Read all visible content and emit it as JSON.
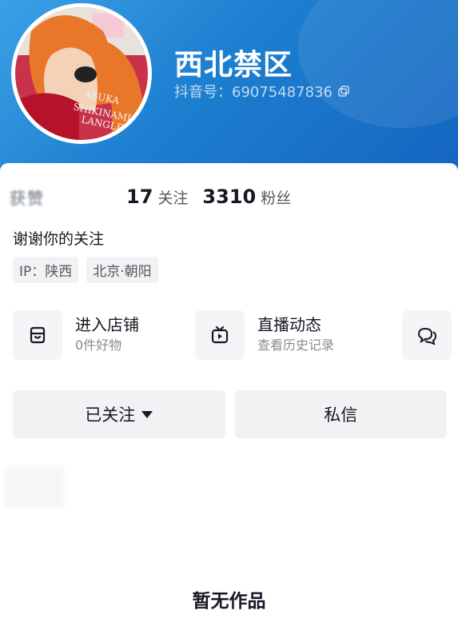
{
  "profile": {
    "nickname": "西北禁区",
    "id_label": "抖音号：69075487836",
    "avatar_lettering": [
      "ASUKA",
      "SHIKINAMI",
      "LANGLEY"
    ]
  },
  "stats": {
    "likes_blurred": "获赞",
    "following_count": "17",
    "following_label": "关注",
    "followers_count": "3310",
    "followers_label": "粉丝"
  },
  "signature": "谢谢你的关注",
  "tags": [
    "IP：陕西",
    "北京·朝阳"
  ],
  "features": {
    "shop_title": "进入店铺",
    "shop_sub": "0件好物",
    "live_title": "直播动态",
    "live_sub": "查看历史记录",
    "more_icon": "chat-bubble-icon"
  },
  "actions": {
    "follow_label": "已关注",
    "message_label": "私信"
  },
  "works": {
    "empty_text": "暂无作品"
  },
  "colors": {
    "header_start": "#3aa0e6",
    "header_end": "#1565c0",
    "button_bg": "#f2f2f4"
  }
}
